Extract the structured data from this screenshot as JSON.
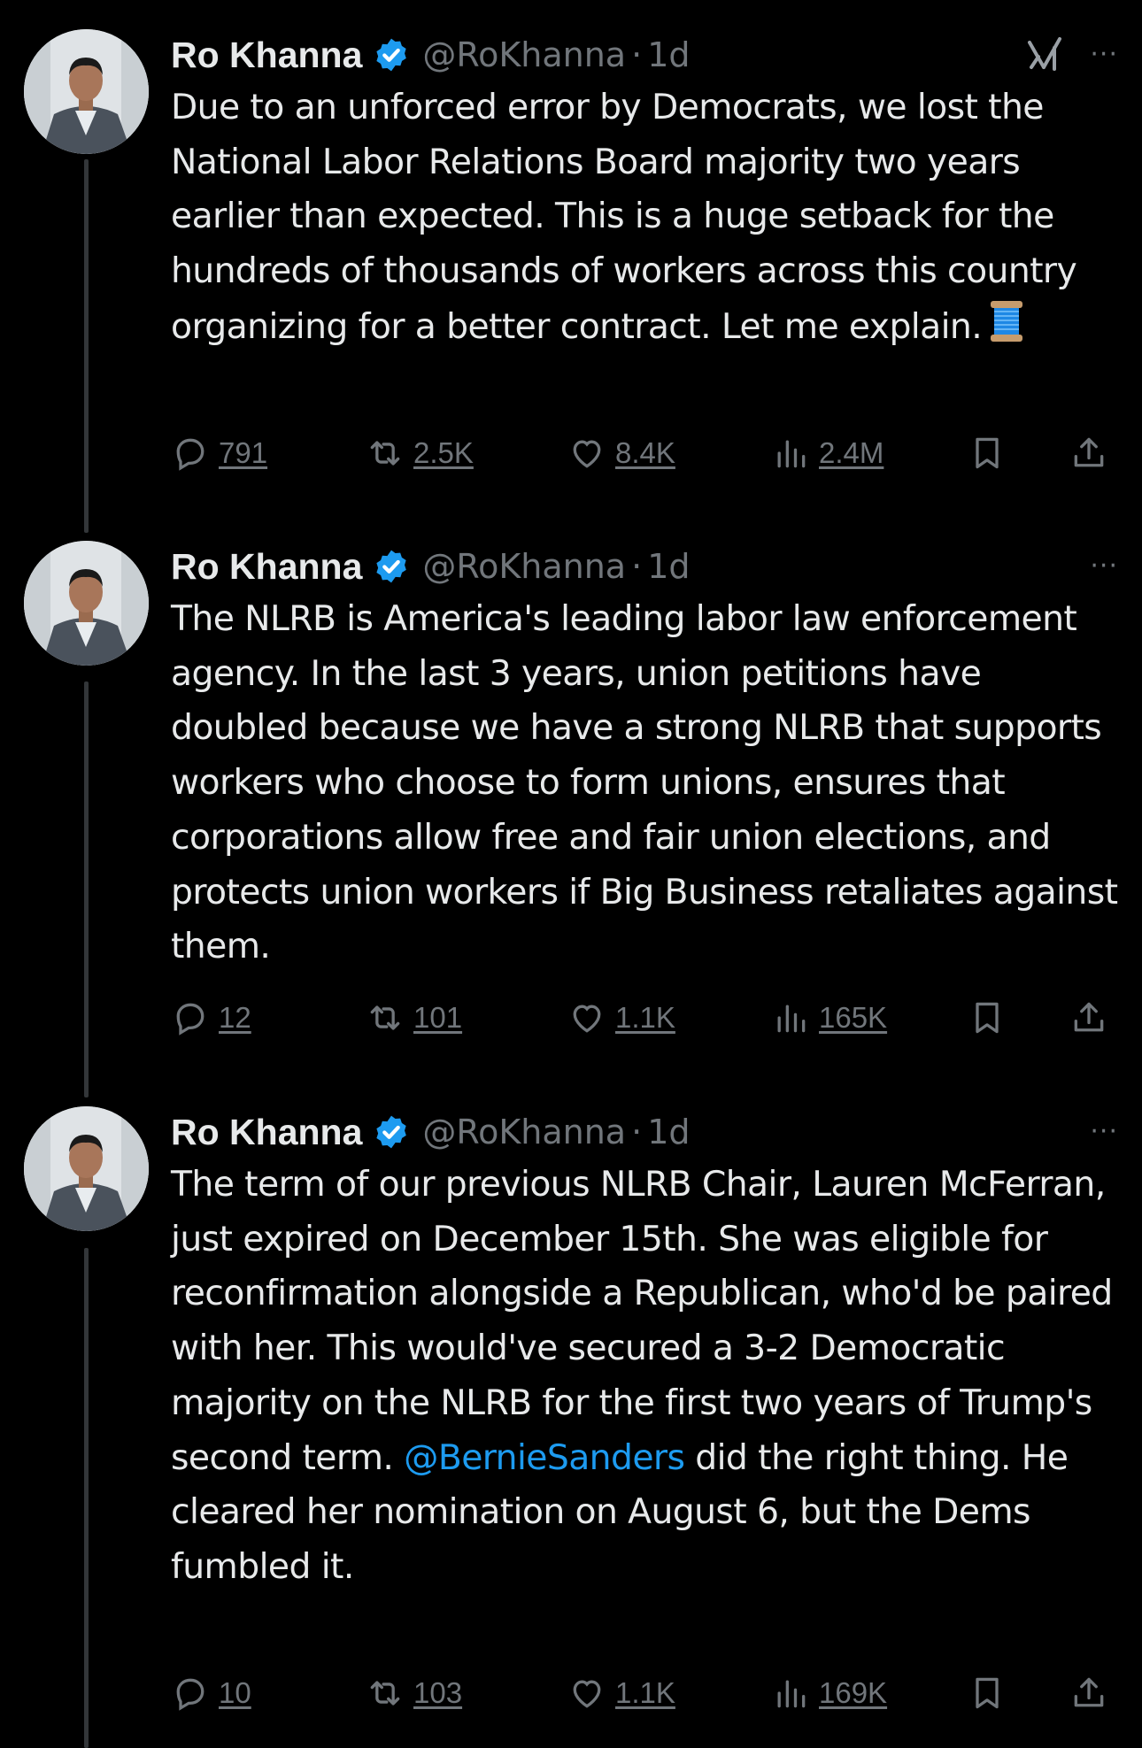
{
  "colors": {
    "background": "#000000",
    "text": "#e7e9ea",
    "muted": "#71767b",
    "accent": "#1d9bf0",
    "thread_line": "#333639"
  },
  "tweets": [
    {
      "author_name": "Ro Khanna",
      "handle": "@RoKhanna",
      "separator": "·",
      "time": "1d",
      "show_grok": true,
      "text": "Due to an unforced error by Democrats, we lost the National Labor Relations Board majority two years earlier than expected. This is a huge setback for the hundreds of thousands of workers across this country organizing for a better contract. Let me explain.",
      "emoji": "thread-spool",
      "replies": "791",
      "reposts": "2.5K",
      "likes": "8.4K",
      "views": "2.4M"
    },
    {
      "author_name": "Ro Khanna",
      "handle": "@RoKhanna",
      "separator": "·",
      "time": "1d",
      "show_grok": false,
      "text": "The NLRB is America's leading labor law enforcement agency. In the last 3 years, union petitions have doubled because we have a strong NLRB that supports workers who choose to form unions, ensures that corporations allow free and fair union elections, and protects union workers if Big Business retaliates against them.",
      "replies": "12",
      "reposts": "101",
      "likes": "1.1K",
      "views": "165K"
    },
    {
      "author_name": "Ro Khanna",
      "handle": "@RoKhanna",
      "separator": "·",
      "time": "1d",
      "show_grok": false,
      "text_before": "The term of our previous NLRB Chair, Lauren McFerran, just expired on December 15th. She was eligible for reconfirmation alongside a Republican, who'd be paired with her. This would've secured a 3-2 Democratic majority on the NLRB for the first two years of Trump's second term. ",
      "mention": "@BernieSanders",
      "text_after": " did the right thing. He cleared her nomination on August 6, but the Dems fumbled it.",
      "replies": "10",
      "reposts": "103",
      "likes": "1.1K",
      "views": "169K"
    }
  ],
  "icons": {
    "verified": "verified-badge-icon",
    "grok": "grok-icon",
    "more": "more-icon",
    "reply": "reply-icon",
    "repost": "repost-icon",
    "like": "like-icon",
    "views": "views-icon",
    "bookmark": "bookmark-icon",
    "share": "share-icon"
  },
  "more_glyph": "···"
}
